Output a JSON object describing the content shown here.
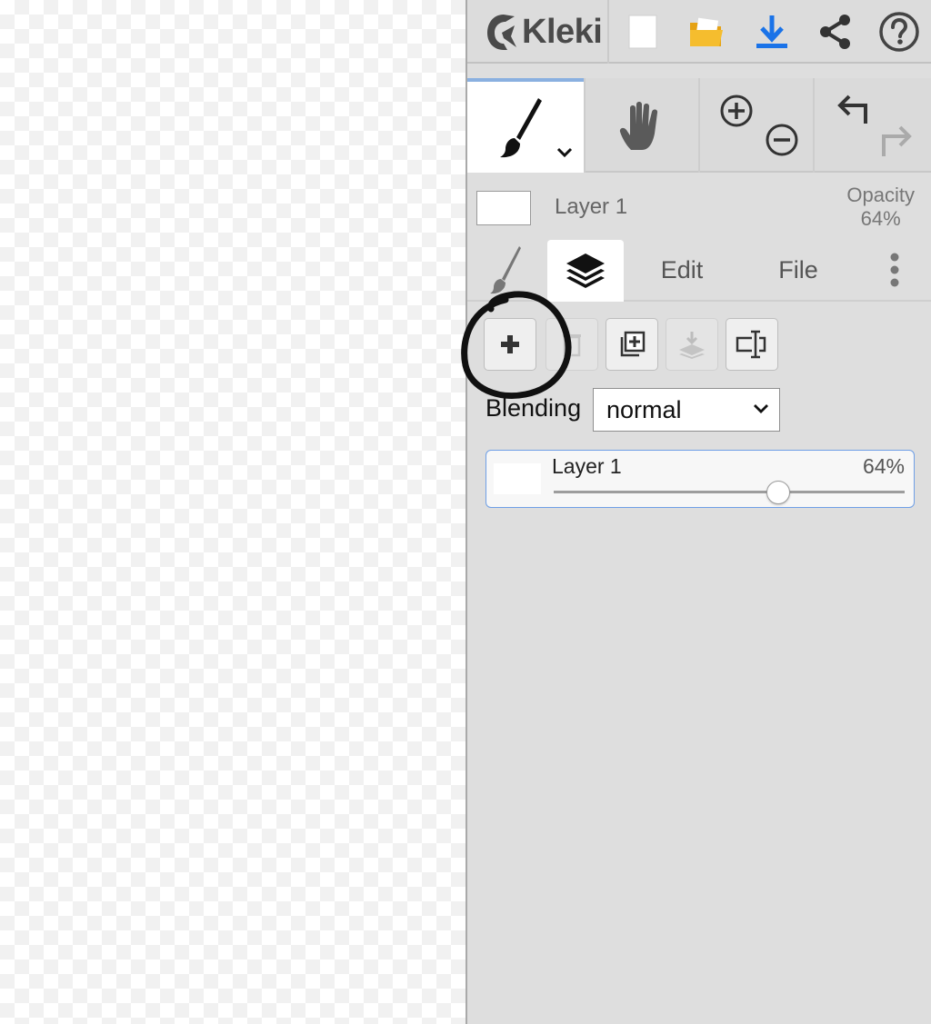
{
  "app": {
    "name": "Kleki"
  },
  "toolbar": {
    "new_icon": "new-document-icon",
    "open_icon": "folder-icon",
    "save_icon": "download-icon",
    "share_icon": "share-icon",
    "help_icon": "help-icon"
  },
  "layer_info": {
    "name": "Layer 1",
    "opacity_label": "Opacity",
    "opacity_value": "64%"
  },
  "tabs": [
    {
      "label": ""
    },
    {
      "label": ""
    },
    {
      "label": "Edit"
    },
    {
      "label": "File"
    }
  ],
  "layers_panel": {
    "blending_label": "Blending",
    "blending_value": "normal",
    "layers": [
      {
        "name": "Layer 1",
        "opacity": "64%",
        "opacity_fraction": 0.64
      }
    ]
  },
  "colors": {
    "accent": "#8ab0e0",
    "selected_border": "#6f9fe6",
    "download": "#1a73e8",
    "folder": "#f3b51a"
  }
}
